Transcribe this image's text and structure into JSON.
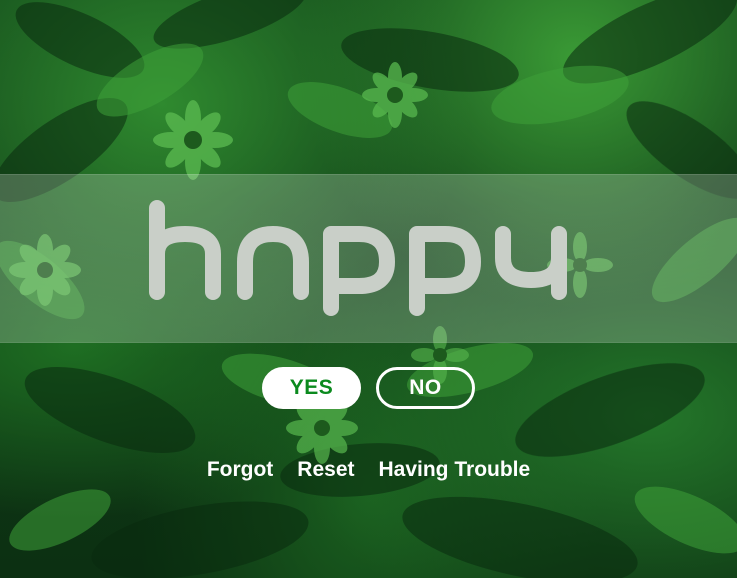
{
  "app": {
    "logo_text": "happy"
  },
  "buttons": {
    "yes_label": "YES",
    "no_label": "NO"
  },
  "links": [
    {
      "label": "Forgot"
    },
    {
      "label": "Reset"
    },
    {
      "label": "Having Trouble"
    }
  ],
  "colors": {
    "accent_green": "#0b8a1e",
    "logo_gray": "#c9cfc8",
    "button_white": "#ffffff"
  },
  "icons": {
    "background": "leaf-foliage-image",
    "logo": "happy-wordmark-logo"
  }
}
